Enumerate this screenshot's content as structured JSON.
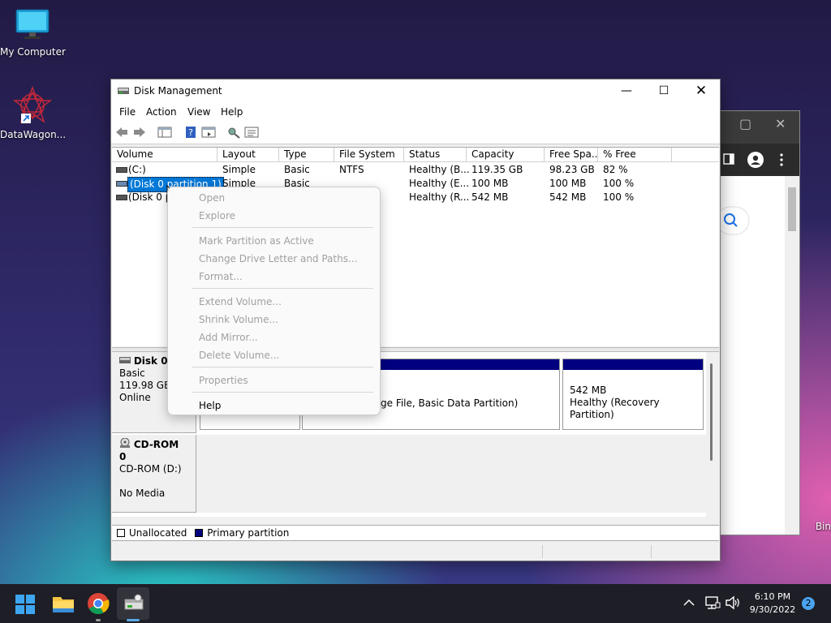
{
  "desktop": {
    "icons": [
      {
        "label": "My Computer"
      },
      {
        "label": "DataWagon..."
      },
      {
        "label": "Bin"
      }
    ]
  },
  "window": {
    "title": "Disk Management",
    "menu": [
      "File",
      "Action",
      "View",
      "Help"
    ]
  },
  "volume_list": {
    "columns": [
      "Volume",
      "Layout",
      "Type",
      "File System",
      "Status",
      "Capacity",
      "Free Spa...",
      "% Free"
    ],
    "rows": [
      {
        "volume": " (C:)",
        "layout": "Simple",
        "type": "Basic",
        "fs": "NTFS",
        "status": "Healthy (B...",
        "capacity": "119.35 GB",
        "free": "98.23 GB",
        "pct": "82 %"
      },
      {
        "volume": "(Disk 0 partition 1)",
        "layout": "Simple",
        "type": "Basic",
        "fs": "",
        "status": "Healthy (E...",
        "capacity": "100 MB",
        "free": "100 MB",
        "pct": "100 %"
      },
      {
        "volume": "(Disk 0 pa",
        "layout": "",
        "type": "",
        "fs": "",
        "status": "Healthy (R...",
        "capacity": "542 MB",
        "free": "542 MB",
        "pct": "100 %"
      }
    ]
  },
  "disks": [
    {
      "name": "Disk 0",
      "type": "Basic",
      "size": "119.98 GB",
      "state": "Online"
    },
    {
      "name": "CD-ROM 0",
      "type": "CD-ROM (D:)",
      "size": "",
      "state": "No Media"
    }
  ],
  "partitions": [
    {
      "text": "ge File, Basic Data Partition)"
    },
    {
      "size": "542 MB",
      "status": "Healthy (Recovery Partition)"
    }
  ],
  "legend": {
    "unallocated": "Unallocated",
    "primary": "Primary partition"
  },
  "context_menu": {
    "items": [
      "Open",
      "Explore",
      "Mark Partition as Active",
      "Change Drive Letter and Paths...",
      "Format...",
      "Extend Volume...",
      "Shrink Volume...",
      "Add Mirror...",
      "Delete Volume...",
      "Properties",
      "Help"
    ]
  },
  "taskbar": {
    "time": "6:10 PM",
    "date": "9/30/2022",
    "notifications": "2"
  },
  "colors": {
    "primary_partition": "#000080",
    "selection": "#0078d7"
  }
}
